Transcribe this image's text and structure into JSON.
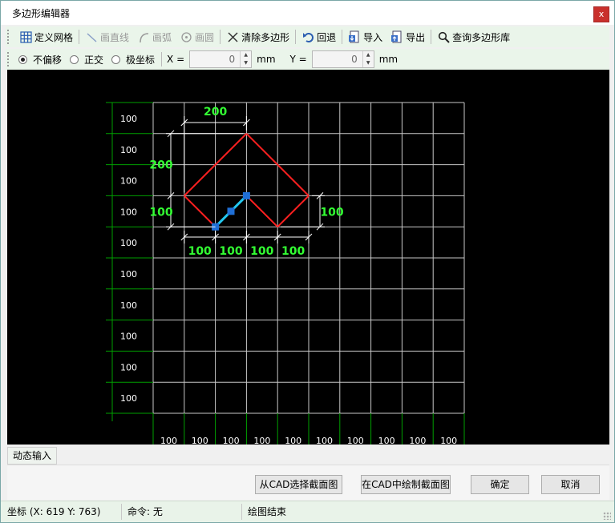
{
  "window": {
    "title": "多边形编辑器",
    "close_label": "x"
  },
  "toolbar": {
    "items": [
      {
        "id": "define-grid",
        "label": "定义网格",
        "enabled": true,
        "icon": "grid-icon"
      },
      {
        "id": "draw-line",
        "label": "画直线",
        "enabled": false,
        "icon": "line-icon"
      },
      {
        "id": "draw-arc",
        "label": "画弧",
        "enabled": false,
        "icon": "arc-icon"
      },
      {
        "id": "draw-circle",
        "label": "画圆",
        "enabled": false,
        "icon": "circle-icon"
      },
      {
        "id": "clear-polygon",
        "label": "清除多边形",
        "enabled": true,
        "icon": "x-icon"
      },
      {
        "id": "undo",
        "label": "回退",
        "enabled": true,
        "icon": "undo-icon"
      },
      {
        "id": "import",
        "label": "导入",
        "enabled": true,
        "icon": "import-icon"
      },
      {
        "id": "export",
        "label": "导出",
        "enabled": true,
        "icon": "export-icon"
      },
      {
        "id": "query-library",
        "label": "查询多边形库",
        "enabled": true,
        "icon": "magnifier-icon"
      }
    ]
  },
  "snap_options": {
    "modes": [
      {
        "label": "不偏移",
        "selected": true
      },
      {
        "label": "正交",
        "selected": false
      },
      {
        "label": "极坐标",
        "selected": false
      }
    ],
    "x_label": "X =",
    "x_value": "0",
    "y_label": "Y =",
    "y_value": "0",
    "unit": "mm"
  },
  "canvas": {
    "row_labels": [
      "100",
      "100",
      "100",
      "100",
      "100",
      "100",
      "100",
      "100",
      "100",
      "100"
    ],
    "column_labels": [
      "100",
      "100",
      "100",
      "100",
      "100",
      "100",
      "100",
      "100",
      "100",
      "100"
    ],
    "dimensions": {
      "top_width": "200",
      "left_height": "200",
      "left_small": "100",
      "right_small": "100",
      "bottom_segments": [
        "100",
        "100",
        "100",
        "100"
      ]
    },
    "colors": {
      "background": "#000000",
      "grid": "#c8c8c8",
      "ruler": "#00a000",
      "polygon": "#ff2020",
      "dimension_text": "#33ff33",
      "dimension_line": "#ffffff",
      "active_segment": "#22c8f0",
      "vertex": "#1f6fd6"
    }
  },
  "dynamic_input_tab": "动态输入",
  "buttons": {
    "select_from_cad": "从CAD选择截面图",
    "draw_in_cad": "在CAD中绘制截面图",
    "ok": "确定",
    "cancel": "取消"
  },
  "statusbar": {
    "coords": "坐标 (X: 619 Y: 763)",
    "command": "命令: 无",
    "message": "绘图结束"
  }
}
